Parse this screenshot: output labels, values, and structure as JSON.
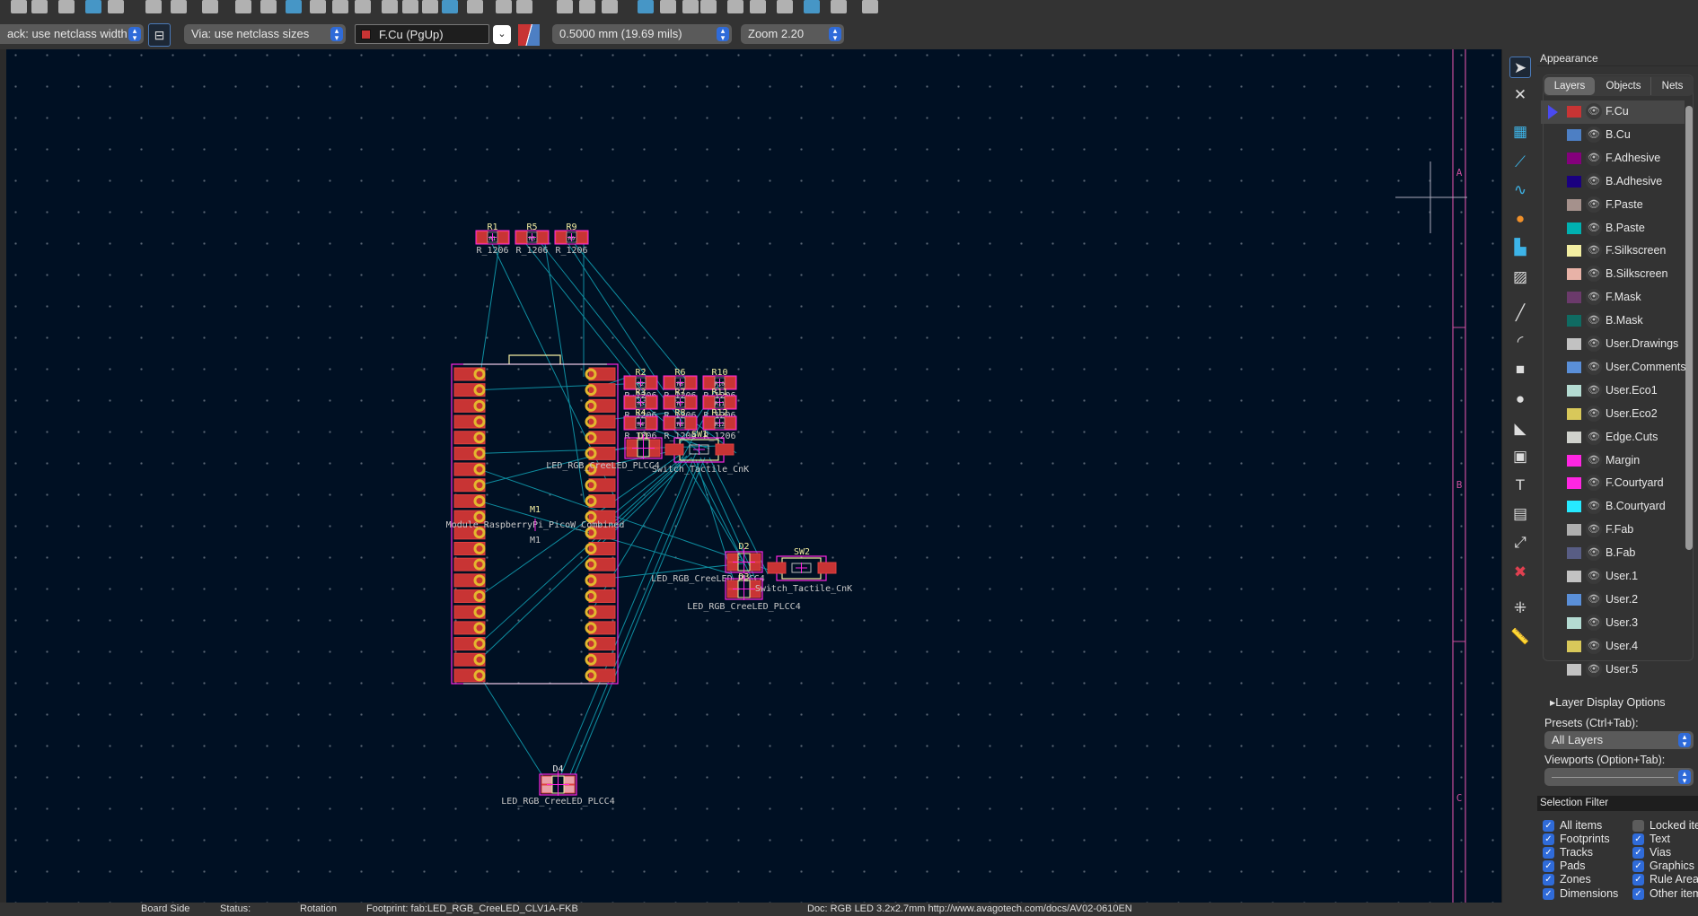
{
  "toolbar": {
    "track_width": "ack: use netclass width",
    "via_size": "Via: use netclass sizes",
    "layer": "F.Cu (PgUp)",
    "grid": "0.5000 mm (19.69 mils)",
    "zoom": "Zoom 2.20",
    "layer_color": "#c83434"
  },
  "canvas": {
    "border_labels": [
      "A",
      "B",
      "C"
    ],
    "footprints": {
      "r_top": [
        {
          "ref": "R1",
          "value": "R_1206"
        },
        {
          "ref": "R5",
          "value": "R_1206"
        },
        {
          "ref": "R9",
          "value": "R_1206"
        }
      ],
      "r_grid": [
        {
          "ref": "R2",
          "value": "R_1206"
        },
        {
          "ref": "R6",
          "value": "R_1206"
        },
        {
          "ref": "R10",
          "value": "R_1206"
        },
        {
          "ref": "R3",
          "value": "R_1206"
        },
        {
          "ref": "R7",
          "value": "R_1206"
        },
        {
          "ref": "R11",
          "value": "R_1206"
        },
        {
          "ref": "R4",
          "value": "R_1206"
        },
        {
          "ref": "R8",
          "value": "R_1206"
        },
        {
          "ref": "R12",
          "value": "R_1206"
        }
      ],
      "m1": {
        "ref": "M1",
        "value": "Module_RaspberryPi_PicoW_Combined",
        "fab_ref": "M1"
      },
      "d1": {
        "ref": "D1",
        "value": "LED_RGB_CreeLED_PLCC4"
      },
      "sw1": {
        "ref": "SW1",
        "value": "Switch_Tactile_CnK"
      },
      "d2": {
        "ref": "D2",
        "value": "LED_RGB_CreeLED_PLCC4"
      },
      "d3": {
        "ref": "D3",
        "value": "LED_RGB_CreeLED_PLCC4"
      },
      "sw2": {
        "ref": "SW2",
        "value": "Switch_Tactile_CnK"
      },
      "d4": {
        "ref": "D4",
        "value": "LED_RGB_CreeLED_PLCC4"
      }
    },
    "colors": {
      "background": "#001023",
      "pad": "#c83434",
      "silkscreen": "#f2eda1",
      "courtyard": "#ff26e2",
      "ratsnest": "#0e8da0",
      "hole": "#e3b72e"
    }
  },
  "right_toolbar": [
    "select-icon",
    "local-ratsnest-icon",
    "footprint-icon",
    "route-track-icon",
    "tune-length-icon",
    "via-icon",
    "pad-icon",
    "zone-icon",
    "line-icon",
    "arc-icon",
    "rectangle-icon",
    "circle-icon",
    "polygon-icon",
    "image-icon",
    "text-icon",
    "textbox-icon",
    "dimension-icon",
    "delete-icon",
    "grid-origin-icon",
    "measure-icon"
  ],
  "appearance": {
    "title": "Appearance",
    "tabs": [
      "Layers",
      "Objects",
      "Nets"
    ],
    "layers": [
      {
        "name": "F.Cu",
        "color": "#c83434"
      },
      {
        "name": "B.Cu",
        "color": "#4d7fc4"
      },
      {
        "name": "F.Adhesive",
        "color": "#84007c"
      },
      {
        "name": "B.Adhesive",
        "color": "#1a0080"
      },
      {
        "name": "F.Paste",
        "color": "#a5918c"
      },
      {
        "name": "B.Paste",
        "color": "#00b1b1"
      },
      {
        "name": "F.Silkscreen",
        "color": "#f2eda1"
      },
      {
        "name": "B.Silkscreen",
        "color": "#e8b2a7"
      },
      {
        "name": "F.Mask",
        "color": "#6b3a6b"
      },
      {
        "name": "B.Mask",
        "color": "#0f6b62"
      },
      {
        "name": "User.Drawings",
        "color": "#c2c2c2"
      },
      {
        "name": "User.Comments",
        "color": "#5a8fd8"
      },
      {
        "name": "User.Eco1",
        "color": "#b4dbd2"
      },
      {
        "name": "User.Eco2",
        "color": "#d8c85a"
      },
      {
        "name": "Edge.Cuts",
        "color": "#d0d2cd"
      },
      {
        "name": "Margin",
        "color": "#ff26e2"
      },
      {
        "name": "F.Courtyard",
        "color": "#ff26e2"
      },
      {
        "name": "B.Courtyard",
        "color": "#26e9ff"
      },
      {
        "name": "F.Fab",
        "color": "#afafaf"
      },
      {
        "name": "B.Fab",
        "color": "#585d84"
      },
      {
        "name": "User.1",
        "color": "#c2c2c2"
      },
      {
        "name": "User.2",
        "color": "#5a8fd8"
      },
      {
        "name": "User.3",
        "color": "#b4dbd2"
      },
      {
        "name": "User.4",
        "color": "#d8c85a"
      },
      {
        "name": "User.5",
        "color": "#c2c2c2"
      }
    ],
    "active_layer": "F.Cu",
    "layer_display_options": "Layer Display Options",
    "presets_label": "Presets (Ctrl+Tab):",
    "presets_value": "All Layers",
    "viewports_label": "Viewports (Option+Tab):",
    "viewports_value": ""
  },
  "selection_filter": {
    "title": "Selection Filter",
    "items": [
      {
        "label": "All items",
        "checked": true
      },
      {
        "label": "Locked items",
        "checked": false
      },
      {
        "label": "Footprints",
        "checked": true
      },
      {
        "label": "Text",
        "checked": true
      },
      {
        "label": "Tracks",
        "checked": true
      },
      {
        "label": "Vias",
        "checked": true
      },
      {
        "label": "Pads",
        "checked": true
      },
      {
        "label": "Graphics",
        "checked": true
      },
      {
        "label": "Zones",
        "checked": true
      },
      {
        "label": "Rule Areas",
        "checked": true
      },
      {
        "label": "Dimensions",
        "checked": true
      },
      {
        "label": "Other items",
        "checked": true
      }
    ]
  },
  "status": {
    "board_side": "Board Side",
    "status": "Status:",
    "rotation": "Rotation",
    "footprint": "Footprint: fab:LED_RGB_CreeLED_CLV1A-FKB",
    "doc": "Doc: RGB LED 3.2x2.7mm http://www.avagotech.com/docs/AV02-0610EN"
  }
}
